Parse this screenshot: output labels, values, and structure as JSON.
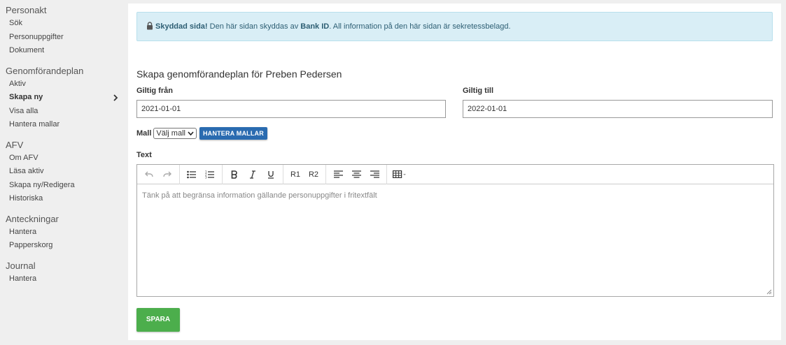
{
  "sidebar": {
    "sections": [
      {
        "heading": "Personakt",
        "items": [
          "Sök",
          "Personuppgifter",
          "Dokument"
        ]
      },
      {
        "heading": "Genomförandeplan",
        "items": [
          "Aktiv",
          "Skapa ny",
          "Visa alla",
          "Hantera mallar"
        ]
      },
      {
        "heading": "AFV",
        "items": [
          "Om AFV",
          "Läsa aktiv",
          "Skapa ny/Redigera",
          "Historiska"
        ]
      },
      {
        "heading": "Anteckningar",
        "items": [
          "Hantera",
          "Papperskorg"
        ]
      },
      {
        "heading": "Journal",
        "items": [
          "Hantera"
        ]
      }
    ],
    "active_item": "Skapa ny"
  },
  "alert": {
    "icon": "lock-icon",
    "bold_text": "Skyddad sida!",
    "text_before": " Den här sidan skyddas av ",
    "bank_id": "Bank ID",
    "text_after": ". All information på den här sidan är sekretessbelagd."
  },
  "form": {
    "title": "Skapa genomförandeplan för Preben Pedersen",
    "valid_from_label": "Giltig från",
    "valid_from_value": "2021-01-01",
    "valid_to_label": "Giltig till",
    "valid_to_value": "2022-01-01",
    "template_label": "Mall",
    "template_select_value": "Välj mall",
    "manage_templates_button": "HANTERA MALLAR",
    "text_label": "Text",
    "toolbar": {
      "r1": "R1",
      "r2": "R2"
    },
    "editor_placeholder": "Tänk på att begränsa information gällande personuppgifter i fritextfält",
    "save_button": "SPARA"
  },
  "colors": {
    "alert_bg": "#d9eef6",
    "alert_text": "#2e5f74",
    "primary_button": "#2a6bb0",
    "save_button": "#4cae4c"
  }
}
